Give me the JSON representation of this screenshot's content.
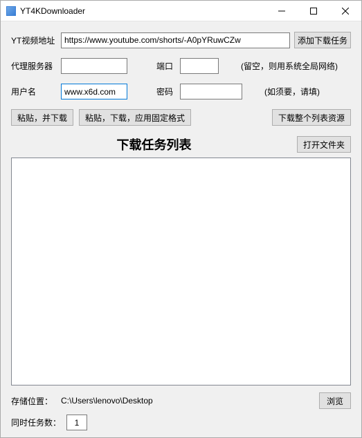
{
  "title": "YT4KDownloader",
  "labels": {
    "url": "YT视频地址",
    "proxy": "代理服务器",
    "port": "端口",
    "user": "用户名",
    "pass": "密码"
  },
  "inputs": {
    "url": "https://www.youtube.com/shorts/-A0pYRuwCZw",
    "proxy": "",
    "port": "",
    "user": "www.x6d.com",
    "pass": ""
  },
  "hints": {
    "proxy": "(留空，则用系统全局网络)",
    "user": "(如须要，请填)"
  },
  "buttons": {
    "add": "添加下载任务",
    "paste_download": "粘贴，并下载",
    "paste_download_format": "粘贴，下载，应用固定格式",
    "download_list": "下载整个列表资源",
    "open_folder": "打开文件夹",
    "browse": "浏览"
  },
  "heading": "下载任务列表",
  "storage": {
    "label": "存储位置：",
    "path": "C:\\Users\\lenovo\\Desktop"
  },
  "concurrent": {
    "label": "同时任务数：",
    "value": "1"
  }
}
